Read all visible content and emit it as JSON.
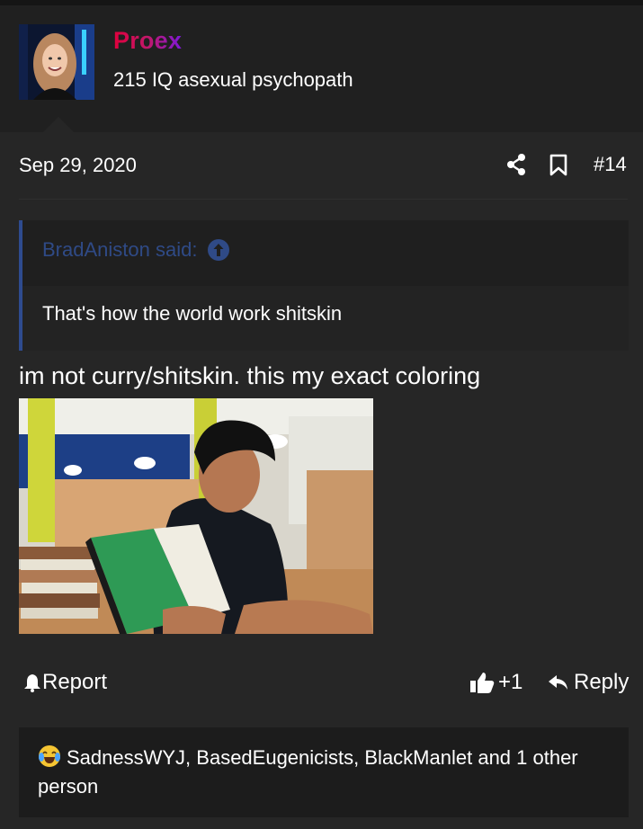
{
  "author": {
    "name": "Proex",
    "title": "215 IQ asexual psychopath",
    "avatar_icon": "user-avatar-photo"
  },
  "post": {
    "date": "Sep 29, 2020",
    "number": "#14",
    "share_icon": "share-icon",
    "bookmark_icon": "bookmark-icon"
  },
  "quote": {
    "author_line": "BradAniston said:",
    "jump_icon": "arrow-up-circle-icon",
    "text": "That's how the world work shitskin"
  },
  "message": {
    "text": "im not curry/shitskin. this my exact coloring",
    "image_icon": "photo-student-reading"
  },
  "actions": {
    "report_label": "Report",
    "like_count": "+1",
    "reply_label": "Reply"
  },
  "reactions": {
    "emoji_icon": "crying-laughing-emoji",
    "text": "SadnessWYJ, BasedEugenicists, BlackManlet and 1 other person"
  },
  "colors": {
    "page_bg": "#1b1b1b",
    "header_bg": "#202020",
    "post_bg": "#262626",
    "quote_accent": "#2e4b8f",
    "username_gradient_start": "#e0003c",
    "username_gradient_end": "#7d18d8"
  }
}
